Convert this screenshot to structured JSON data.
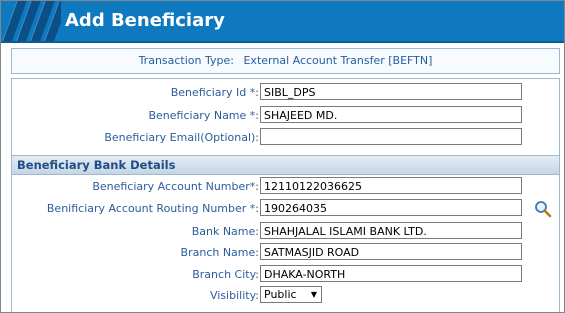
{
  "window": {
    "title": "Add Beneficiary"
  },
  "transaction": {
    "label": "Transaction Type:",
    "value": "External Account Transfer [BEFTN]"
  },
  "beneficiary": {
    "id_label": "Beneficiary Id *:",
    "id_value": "SIBL_DPS",
    "name_label": "Beneficiary Name *:",
    "name_value": "SHAJEED MD.",
    "email_label": "Beneficiary Email(Optional):",
    "email_value": ""
  },
  "bank_details": {
    "section_title": "Beneficiary Bank Details",
    "account_label": "Beneficiary Account Number*:",
    "account_value": "12110122036625",
    "routing_label": "Benificiary Account Routing Number *:",
    "routing_value": "190264035",
    "bank_label": "Bank Name:",
    "bank_value": "SHAHJALAL ISLAMI BANK LTD.",
    "branch_label": "Branch Name:",
    "branch_value": "SATMASJID ROAD",
    "city_label": "Branch City:",
    "city_value": "DHAKA-NORTH",
    "visibility_label": "Visibility:",
    "visibility_value": "Public"
  },
  "icons": {
    "routing_search": "magnifier-icon",
    "dropdown": "chevron-down-icon"
  },
  "colors": {
    "title_bar": "#0e79bf",
    "label_text": "#2a5d9c",
    "section_bg": "#c5d5e5"
  }
}
